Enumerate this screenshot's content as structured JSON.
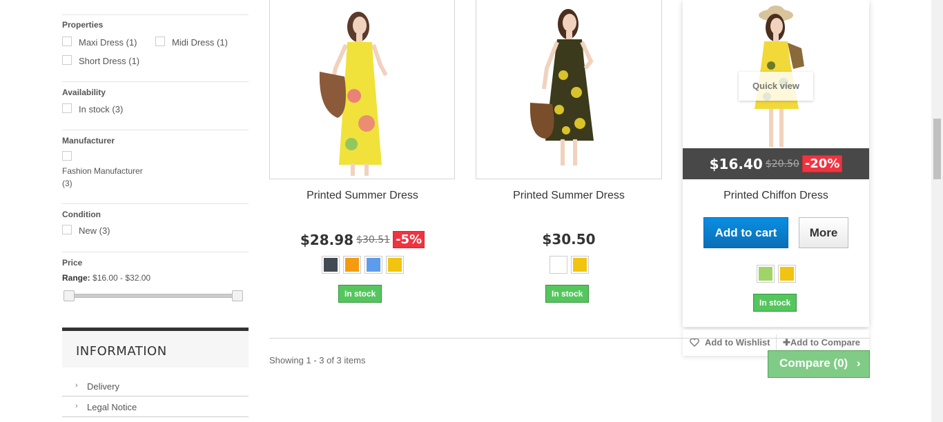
{
  "filters": {
    "properties": {
      "title": "Properties",
      "options": [
        "Maxi Dress (1)",
        "Midi Dress (1)",
        "Short Dress (1)"
      ]
    },
    "availability": {
      "title": "Availability",
      "options": [
        "In stock (3)"
      ]
    },
    "manufacturer": {
      "title": "Manufacturer",
      "option_line1": "Fashion Manufacturer",
      "option_line2": "(3)"
    },
    "condition": {
      "title": "Condition",
      "options": [
        "New (3)"
      ]
    },
    "price": {
      "title": "Price",
      "range_label": "Range:",
      "range_value": "$16.00 - $32.00",
      "min": 16,
      "max": 32
    }
  },
  "information": {
    "title": "INFORMATION",
    "links": [
      "Delivery",
      "Legal Notice"
    ]
  },
  "products": [
    {
      "name": "Printed Summer Dress",
      "price": "$28.98",
      "old_price": "$30.51",
      "discount": "-5%",
      "colors": [
        "#434a54",
        "#f39c11",
        "#5d9cec",
        "#f1c40f"
      ],
      "stock": "In stock",
      "dress_color": "#f0e23a",
      "pattern_color": "#e86a8a"
    },
    {
      "name": "Printed Summer Dress",
      "price": "$30.50",
      "colors": [
        "#ffffff",
        "#f1c40f"
      ],
      "stock": "In stock",
      "dress_color": "#3b3a1c",
      "pattern_color": "#d9c32a"
    },
    {
      "name": "Printed Chiffon Dress",
      "price": "$16.40",
      "old_price": "$20.50",
      "discount": "-20%",
      "colors": [
        "#a0d468",
        "#f1c40f"
      ],
      "stock": "In stock",
      "quick_view": "Quick view",
      "add_to_cart": "Add to cart",
      "more": "More",
      "dress_color": "#f2d93a",
      "pattern_color": "#6a7a2a"
    }
  ],
  "wishlist": {
    "add_to_wishlist": "Add to Wishlist",
    "add_to_compare": "Add to Compare"
  },
  "listing": {
    "showing": "Showing 1 - 3 of 3 items",
    "compare_button": "Compare (0)"
  }
}
